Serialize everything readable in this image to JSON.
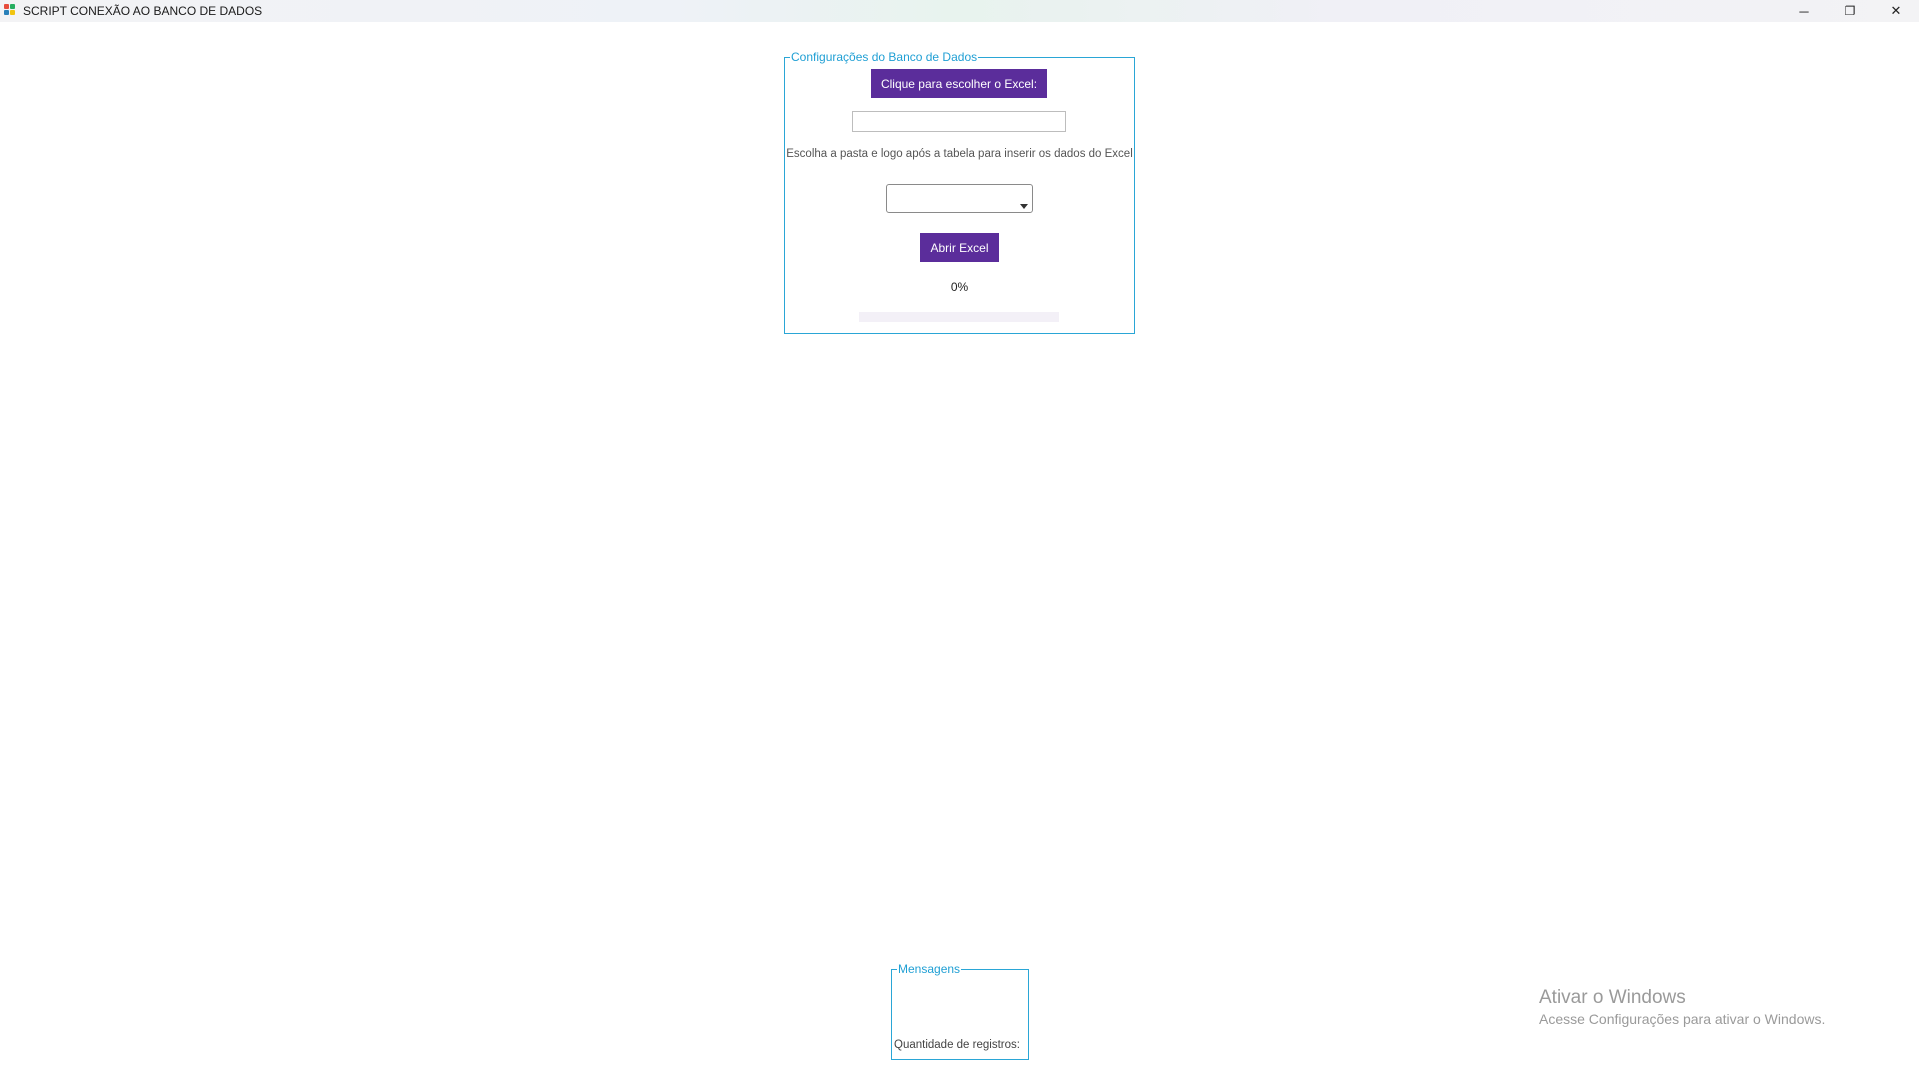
{
  "window": {
    "title": "SCRIPT CONEXÃO AO BANCO DE DADOS",
    "minimize_glyph": "─",
    "maximize_glyph": "❐",
    "close_glyph": "✕",
    "app_icon_colors": [
      "#e74c3c",
      "#27ae60",
      "#2980b9",
      "#f1c40f"
    ]
  },
  "db_config": {
    "legend": "Configurações do Banco de Dados",
    "choose_button_label": "Clique para escolher o Excel:",
    "path_input_value": "",
    "path_input_placeholder": "",
    "instruction": "Escolha a pasta e logo após a tabela para inserir os dados do Excel",
    "table_select_value": "",
    "open_button_label": "Abrir Excel",
    "progress_text": "0%",
    "progress_fraction": 0
  },
  "messages": {
    "legend": "Mensagens",
    "records_label": "Quantidade de registros:"
  },
  "watermark": {
    "title": "Ativar o Windows",
    "subtitle": "Acesse Configurações para ativar o Windows."
  },
  "colors": {
    "accent_purple": "#5b2d9b",
    "group_border": "#2aa6d6",
    "legend_text": "#1f9fd4"
  }
}
